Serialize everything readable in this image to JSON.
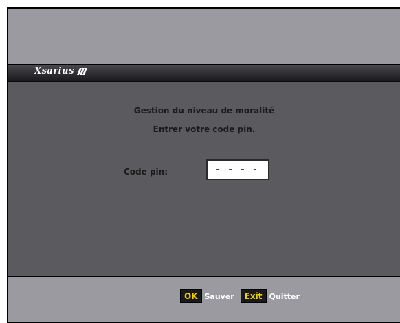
{
  "brand": {
    "logo_text": "Xsarius"
  },
  "dialog": {
    "title": "Gestion du niveau de moralité",
    "instruction": "Entrer votre code pin.",
    "pin_label": "Code pin:",
    "pin_value": "- - - -"
  },
  "footer": {
    "ok_key": "OK",
    "ok_label": "Sauver",
    "exit_key": "Exit",
    "exit_label": "Quitter"
  },
  "colors": {
    "panel": "#5b5a5f",
    "band": "#9b9aa1",
    "key_text": "#f0d000"
  }
}
